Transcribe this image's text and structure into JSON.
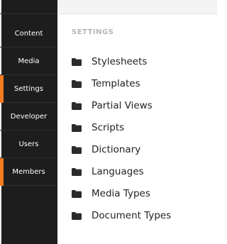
{
  "nav": {
    "items": [
      {
        "label": "Content",
        "active": false
      },
      {
        "label": "Media",
        "active": false
      },
      {
        "label": "Settings",
        "active": true
      },
      {
        "label": "Developer",
        "active": false
      },
      {
        "label": "Users",
        "active": false
      },
      {
        "label": "Members",
        "active": true
      }
    ],
    "accent_color": "#f47b20"
  },
  "settings": {
    "title": "SETTINGS",
    "items": [
      {
        "label": "Stylesheets",
        "icon": "folder-icon"
      },
      {
        "label": "Templates",
        "icon": "folder-icon"
      },
      {
        "label": "Partial Views",
        "icon": "folder-icon"
      },
      {
        "label": "Scripts",
        "icon": "folder-icon"
      },
      {
        "label": "Dictionary",
        "icon": "folder-icon"
      },
      {
        "label": "Languages",
        "icon": "folder-icon"
      },
      {
        "label": "Media Types",
        "icon": "folder-icon"
      },
      {
        "label": "Document Types",
        "icon": "folder-icon"
      }
    ]
  }
}
